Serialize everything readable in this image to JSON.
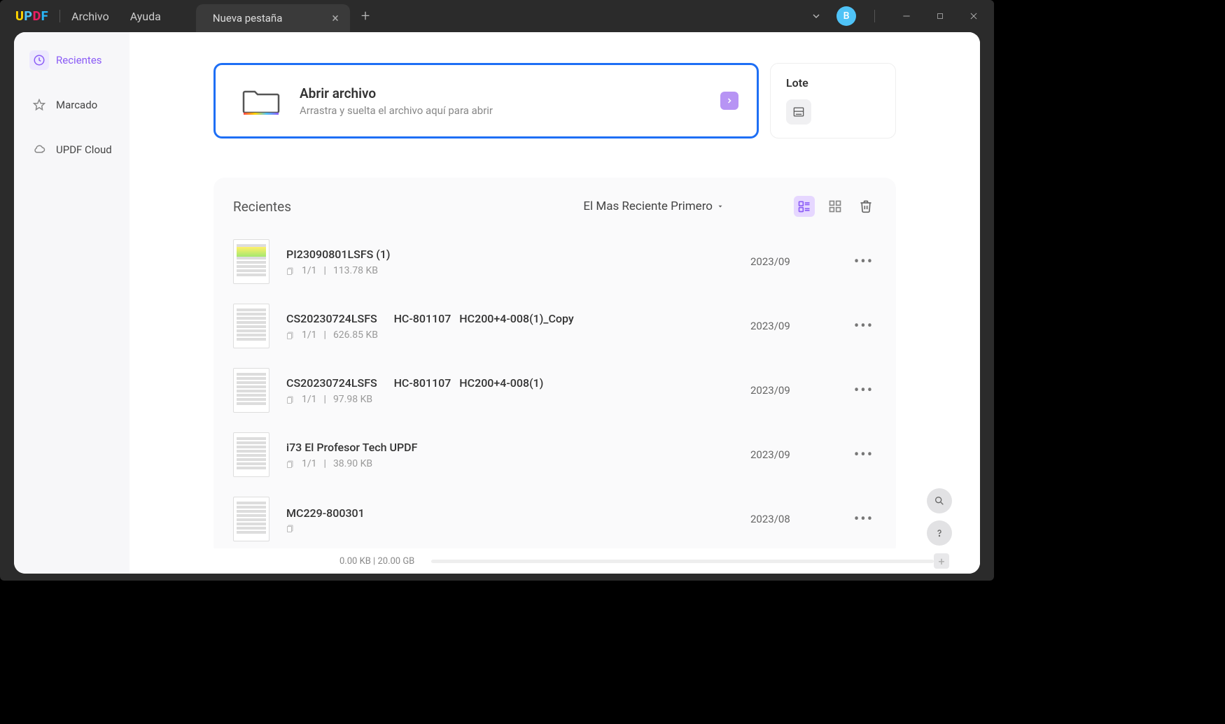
{
  "titlebar": {
    "menu_file": "Archivo",
    "menu_help": "Ayuda",
    "tab_label": "Nueva pestaña",
    "avatar_letter": "B"
  },
  "sidebar": {
    "items": [
      {
        "label": "Recientes"
      },
      {
        "label": "Marcado"
      },
      {
        "label": "UPDF Cloud"
      }
    ]
  },
  "open_card": {
    "title": "Abrir archivo",
    "subtitle": "Arrastra y suelta el archivo aquí para abrir"
  },
  "batch_card": {
    "title": "Lote"
  },
  "recents": {
    "title": "Recientes",
    "sort_label": "El Mas Reciente Primero",
    "files": [
      {
        "name": "PI23090801LSFS (1)",
        "pages": "1/1",
        "size": "113.78 KB",
        "date": "2023/09"
      },
      {
        "name": "CS20230724LSFS      HC-801107   HC200+4-008(1)_Copy",
        "pages": "1/1",
        "size": "626.85 KB",
        "date": "2023/09"
      },
      {
        "name": "CS20230724LSFS      HC-801107   HC200+4-008(1)",
        "pages": "1/1",
        "size": "97.98 KB",
        "date": "2023/09"
      },
      {
        "name": "i73 El Profesor Tech UPDF",
        "pages": "1/1",
        "size": "38.90 KB",
        "date": "2023/09"
      },
      {
        "name": "MC229-800301",
        "pages": "",
        "size": "",
        "date": "2023/08"
      }
    ]
  },
  "storage": {
    "text": "0.00 KB | 20.00 GB"
  }
}
